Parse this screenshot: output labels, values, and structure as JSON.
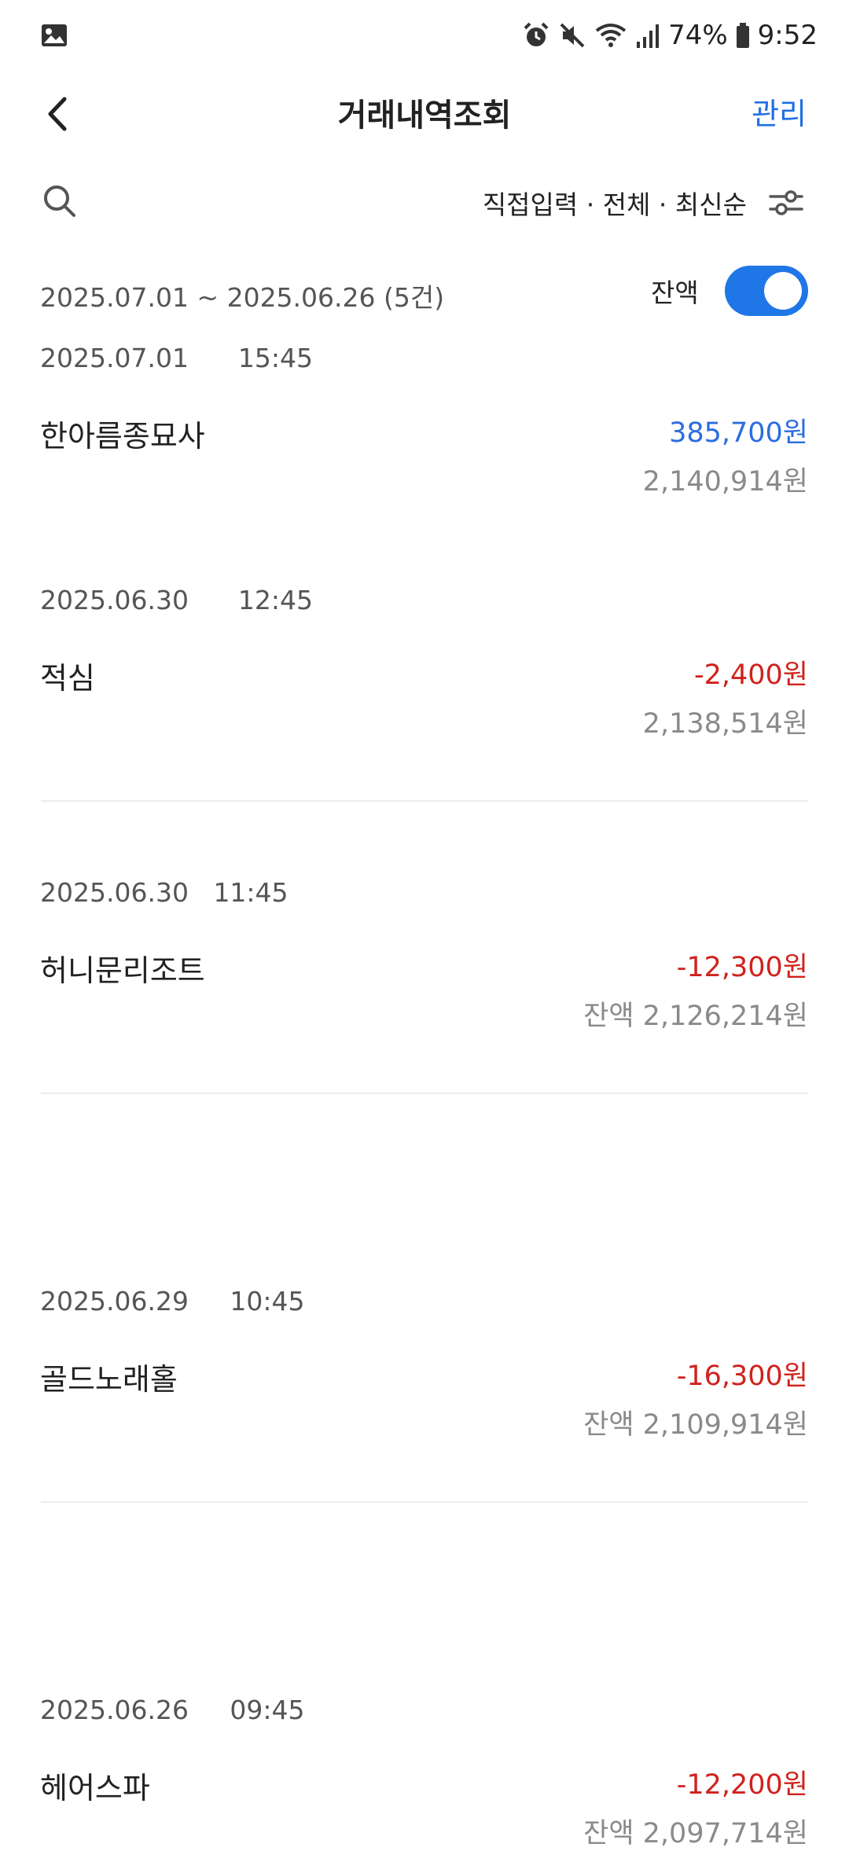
{
  "status_bar": {
    "battery_percent": "74%",
    "time": "9:52",
    "icons": [
      "gallery-icon",
      "alarm-icon",
      "mute-icon",
      "wifi-icon",
      "signal-icon",
      "battery-icon"
    ]
  },
  "header": {
    "title": "거래내역조회",
    "manage_label": "관리"
  },
  "filter": {
    "summary": "직접입력 · 전체 · 최신순"
  },
  "period": {
    "range": "2025.07.01 ~ 2025.06.26 (5건)",
    "balance_toggle_label": "잔액",
    "balance_toggle_on": true
  },
  "transactions": [
    {
      "date": "2025.07.01",
      "time": "15:45",
      "merchant": "한아름종묘사",
      "amount": "385,700원",
      "balance": "2,140,914원",
      "type": "deposit"
    },
    {
      "date": "2025.06.30",
      "time": "12:45",
      "merchant": "적심",
      "amount": "-2,400원",
      "balance": "2,138,514원",
      "type": "withdrawal"
    },
    {
      "date": "2025.06.30",
      "time": "11:45",
      "merchant": "허니문리조트",
      "amount": "-12,300원",
      "balance": "잔액 2,126,214원",
      "type": "withdrawal"
    },
    {
      "date": "2025.06.29",
      "time": "10:45",
      "merchant": "골드노래홀",
      "amount": "-16,300원",
      "balance": "잔액 2,109,914원",
      "type": "withdrawal"
    },
    {
      "date": "2025.06.26",
      "time": "09:45",
      "merchant": "헤어스파",
      "amount": "-12,200원",
      "balance": "잔액 2,097,714원",
      "type": "withdrawal"
    }
  ],
  "colors": {
    "accent": "#1f6fe5",
    "deposit": "#2a6de0",
    "withdrawal": "#d0221c",
    "muted": "#8a8a8a"
  }
}
